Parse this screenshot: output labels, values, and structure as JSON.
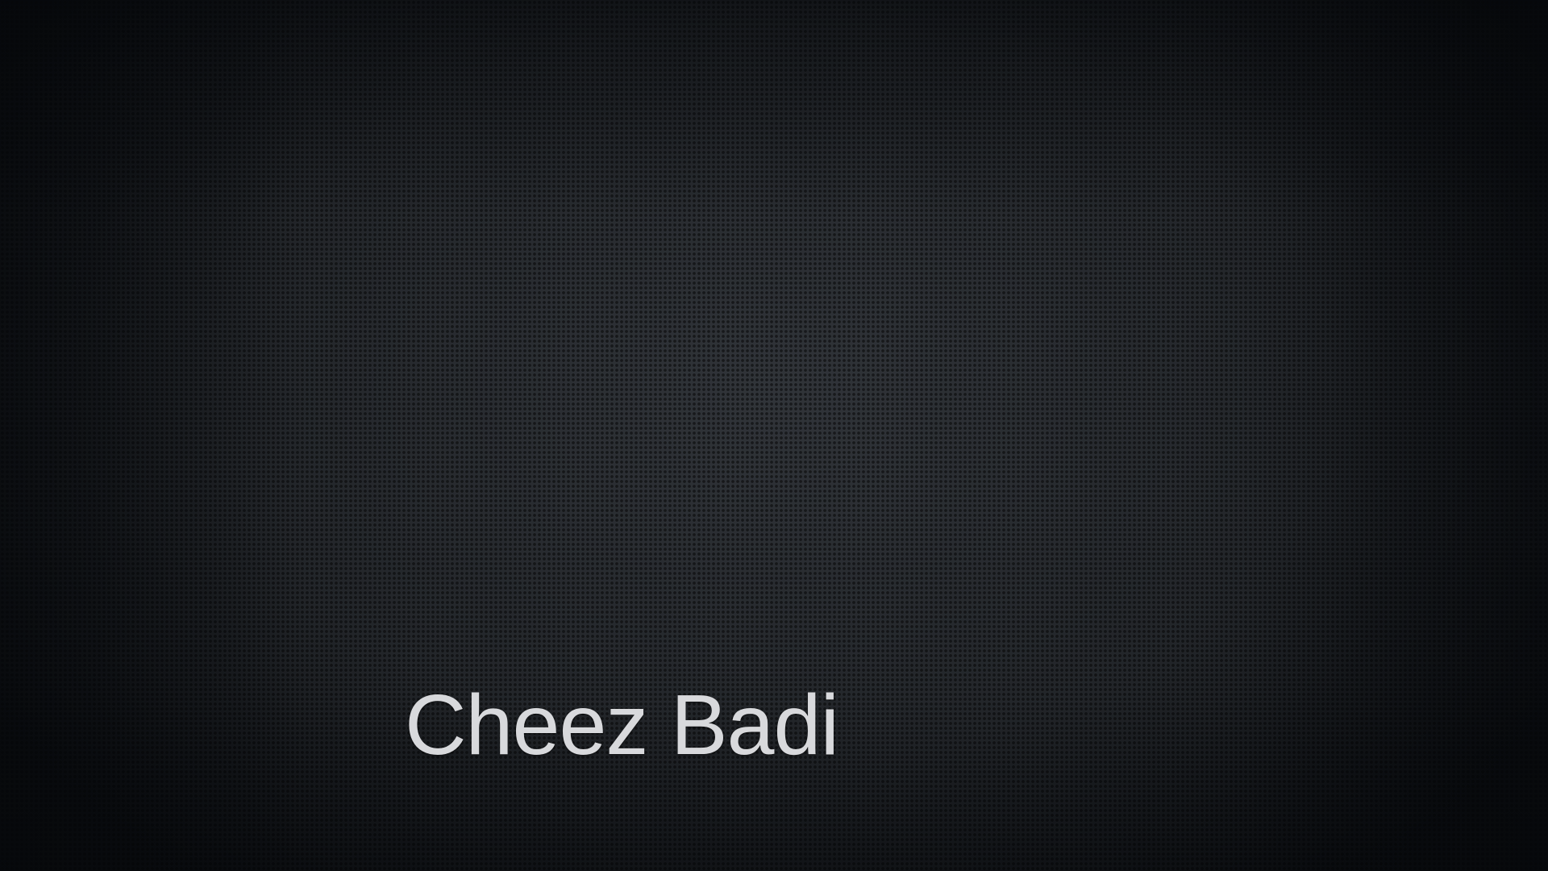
{
  "slide": {
    "title": "Cheez Badi"
  },
  "colors": {
    "background": "#23262a",
    "text": "#d8d9dc"
  }
}
